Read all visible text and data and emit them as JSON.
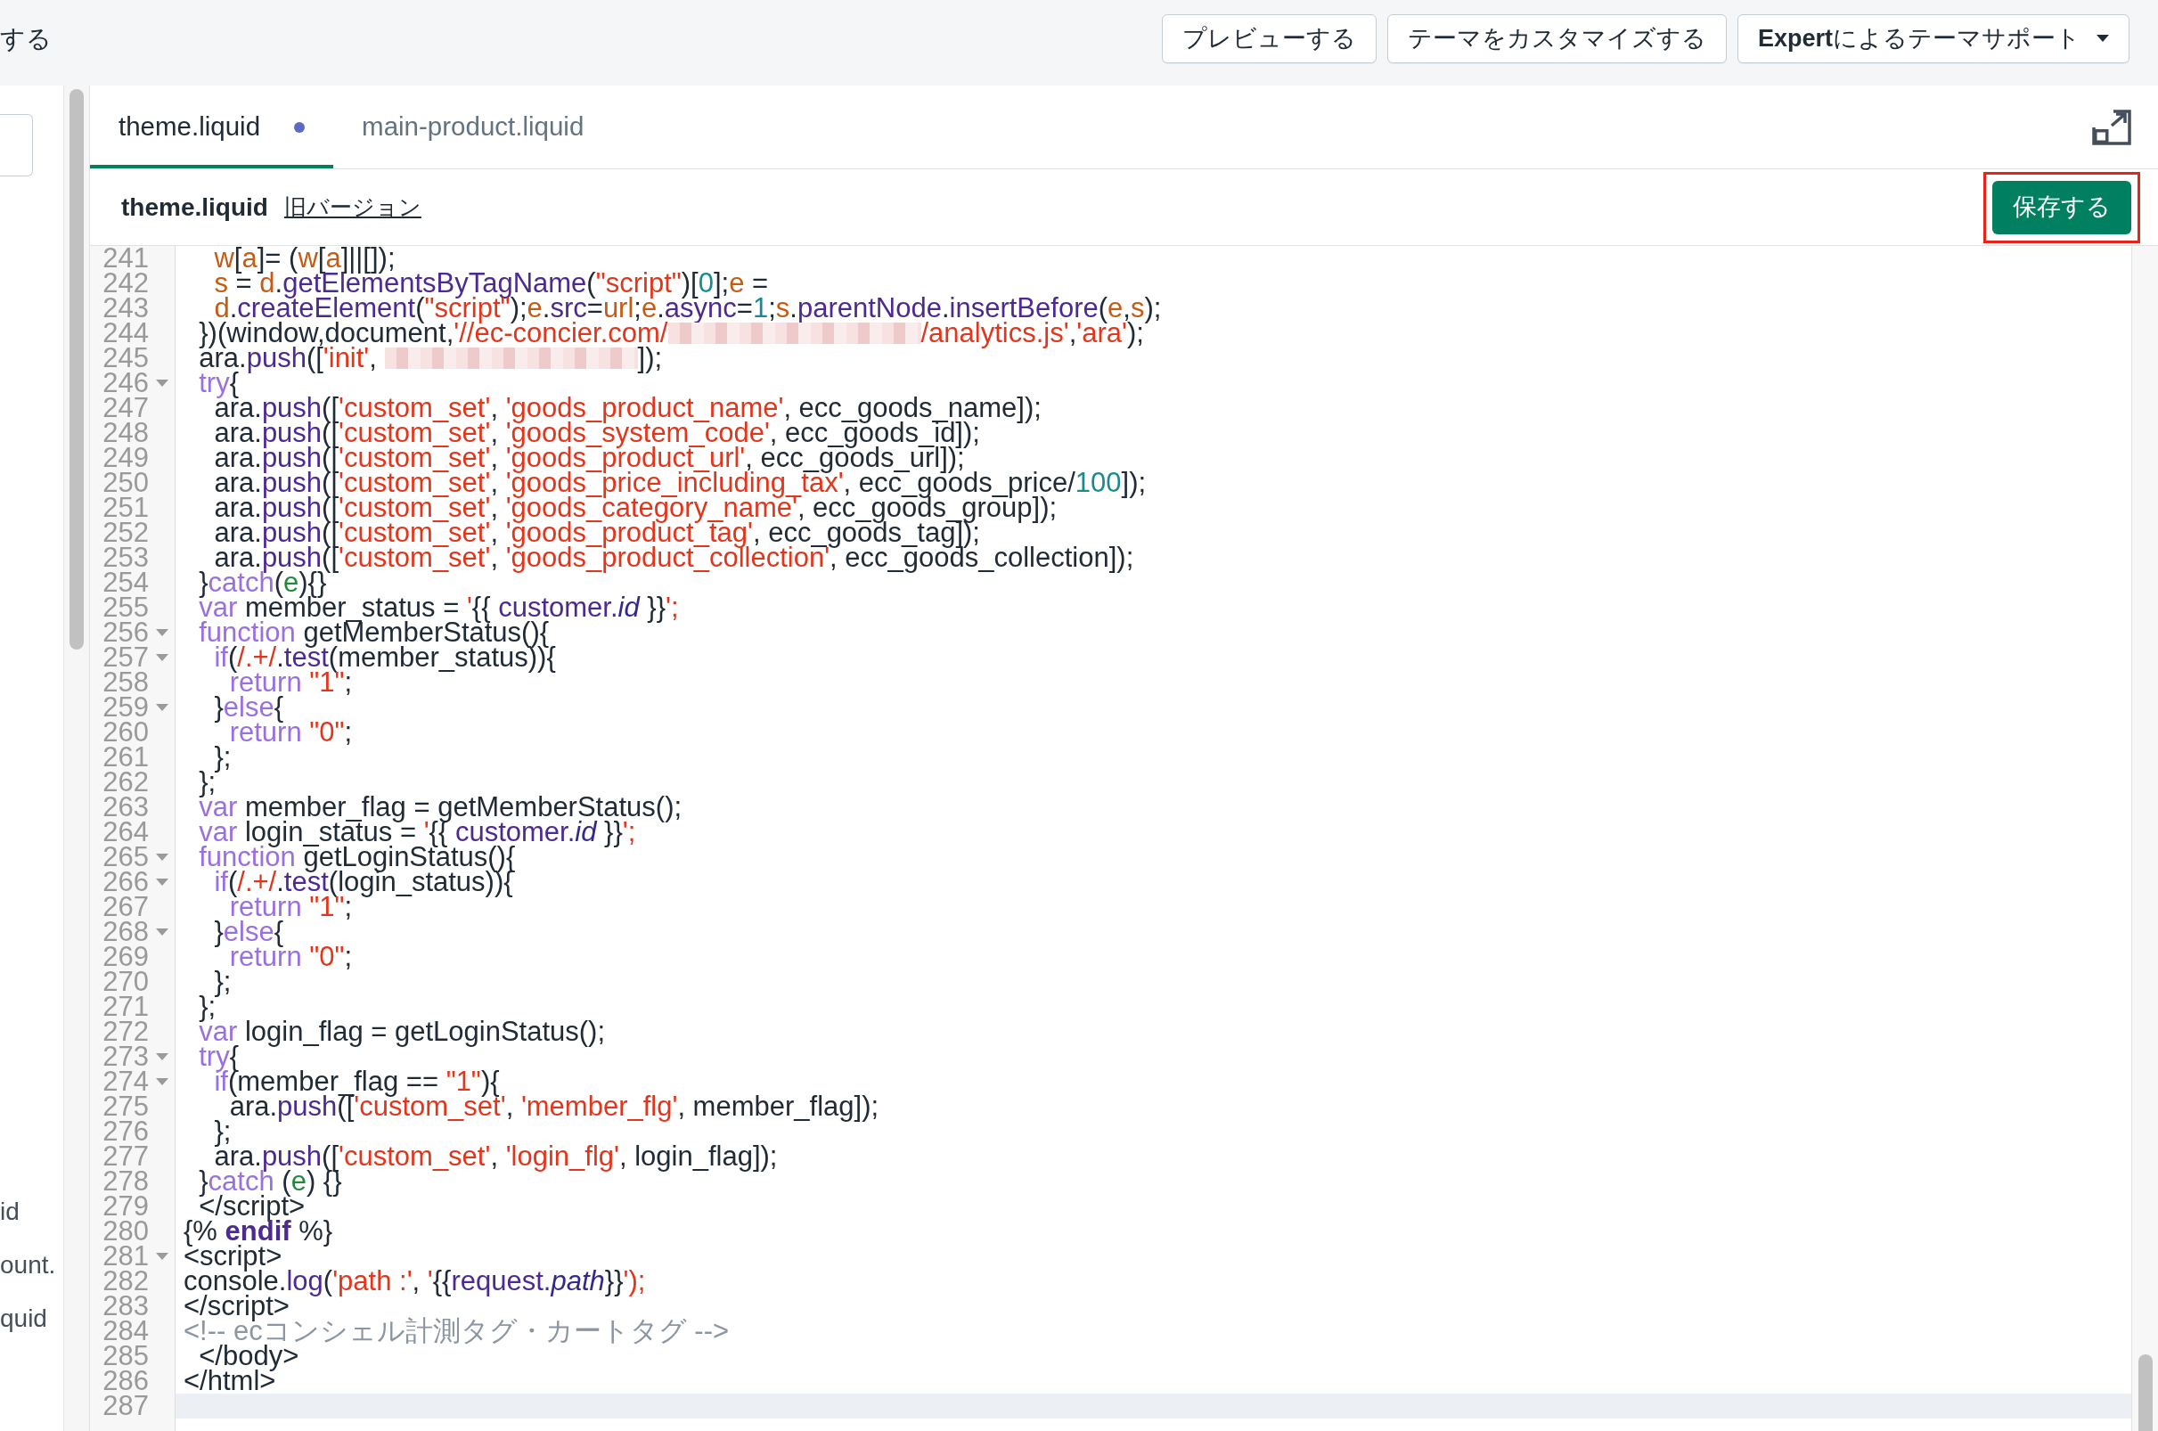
{
  "top_bar": {
    "title": "する",
    "buttons": [
      {
        "label": "プレビューする",
        "kind": "plain"
      },
      {
        "label": "テーマをカスタマイズする",
        "kind": "plain"
      },
      {
        "label": "**Expert**によるテーマサポート",
        "kind": "dropdown"
      }
    ]
  },
  "sidebar": {
    "items": [
      "id",
      "ount.",
      "quid"
    ]
  },
  "editor": {
    "tabs": [
      {
        "label": "theme.liquid",
        "selected": true,
        "modified": true
      },
      {
        "label": "main-product.liquid",
        "selected": false,
        "modified": false
      }
    ],
    "file_title": "theme.liquid",
    "old_version_link": "旧バージョン",
    "save_button": {
      "label": "保存する",
      "highlighted": true
    },
    "lines": [
      {
        "number": "241",
        "foldable": false,
        "active": false,
        "tokens": [
          {
            "kind": "variable",
            "text": "    w"
          },
          {
            "kind": "plain",
            "text": "["
          },
          {
            "kind": "variable",
            "text": "a"
          },
          {
            "kind": "plain",
            "text": "]= ("
          },
          {
            "kind": "variable",
            "text": "w"
          },
          {
            "kind": "plain",
            "text": "["
          },
          {
            "kind": "variable",
            "text": "a"
          },
          {
            "kind": "plain",
            "text": "]||[]);"
          }
        ]
      },
      {
        "number": "242",
        "foldable": false,
        "active": false,
        "tokens": [
          {
            "kind": "variable",
            "text": "    s"
          },
          {
            "kind": "plain",
            "text": " = "
          },
          {
            "kind": "variable",
            "text": "d"
          },
          {
            "kind": "plain",
            "text": "."
          },
          {
            "kind": "property",
            "text": "getElementsByTagName"
          },
          {
            "kind": "plain",
            "text": "("
          },
          {
            "kind": "string",
            "text": "\"script\""
          },
          {
            "kind": "plain",
            "text": ")["
          },
          {
            "kind": "number",
            "text": "0"
          },
          {
            "kind": "plain",
            "text": "];"
          },
          {
            "kind": "variable",
            "text": "e"
          },
          {
            "kind": "plain",
            "text": " ="
          }
        ]
      },
      {
        "number": "243",
        "foldable": false,
        "active": false,
        "tokens": [
          {
            "kind": "variable",
            "text": "    d"
          },
          {
            "kind": "plain",
            "text": "."
          },
          {
            "kind": "property",
            "text": "createElement"
          },
          {
            "kind": "plain",
            "text": "("
          },
          {
            "kind": "string",
            "text": "\"script\""
          },
          {
            "kind": "plain",
            "text": ");"
          },
          {
            "kind": "variable",
            "text": "e"
          },
          {
            "kind": "plain",
            "text": "."
          },
          {
            "kind": "property",
            "text": "src"
          },
          {
            "kind": "plain",
            "text": "="
          },
          {
            "kind": "variable",
            "text": "url"
          },
          {
            "kind": "plain",
            "text": ";"
          },
          {
            "kind": "variable",
            "text": "e"
          },
          {
            "kind": "plain",
            "text": "."
          },
          {
            "kind": "property",
            "text": "async"
          },
          {
            "kind": "plain",
            "text": "="
          },
          {
            "kind": "number",
            "text": "1"
          },
          {
            "kind": "plain",
            "text": ";"
          },
          {
            "kind": "variable",
            "text": "s"
          },
          {
            "kind": "plain",
            "text": "."
          },
          {
            "kind": "property",
            "text": "parentNode"
          },
          {
            "kind": "plain",
            "text": "."
          },
          {
            "kind": "property",
            "text": "insertBefore"
          },
          {
            "kind": "plain",
            "text": "("
          },
          {
            "kind": "variable",
            "text": "e"
          },
          {
            "kind": "plain",
            "text": ","
          },
          {
            "kind": "variable",
            "text": "s"
          },
          {
            "kind": "plain",
            "text": ");"
          }
        ]
      },
      {
        "number": "244",
        "foldable": false,
        "active": false,
        "tokens": [
          {
            "kind": "plain",
            "text": "  })(window,document,"
          },
          {
            "kind": "string",
            "text": "'//ec-concier.com/"
          },
          {
            "kind": "redacted"
          },
          {
            "kind": "string",
            "text": "/analytics.js'"
          },
          {
            "kind": "plain",
            "text": ","
          },
          {
            "kind": "string",
            "text": "'ara'"
          },
          {
            "kind": "plain",
            "text": ");"
          }
        ]
      },
      {
        "number": "245",
        "foldable": false,
        "active": false,
        "tokens": [
          {
            "kind": "plain",
            "text": "  ara."
          },
          {
            "kind": "property",
            "text": "push"
          },
          {
            "kind": "plain",
            "text": "(["
          },
          {
            "kind": "string",
            "text": "'init'"
          },
          {
            "kind": "plain",
            "text": ", "
          },
          {
            "kind": "redacted"
          },
          {
            "kind": "plain",
            "text": "]);"
          }
        ]
      },
      {
        "number": "246",
        "foldable": true,
        "active": false,
        "tokens": [
          {
            "kind": "keyword",
            "text": "  try"
          },
          {
            "kind": "plain",
            "text": "{"
          }
        ]
      },
      {
        "number": "247",
        "foldable": false,
        "active": false,
        "tokens": [
          {
            "kind": "plain",
            "text": "    ara."
          },
          {
            "kind": "property",
            "text": "push"
          },
          {
            "kind": "plain",
            "text": "(["
          },
          {
            "kind": "string",
            "text": "'custom_set'"
          },
          {
            "kind": "plain",
            "text": ", "
          },
          {
            "kind": "string",
            "text": "'goods_product_name'"
          },
          {
            "kind": "plain",
            "text": ", ecc_goods_name]);"
          }
        ]
      },
      {
        "number": "248",
        "foldable": false,
        "active": false,
        "tokens": [
          {
            "kind": "plain",
            "text": "    ara."
          },
          {
            "kind": "property",
            "text": "push"
          },
          {
            "kind": "plain",
            "text": "(["
          },
          {
            "kind": "string",
            "text": "'custom_set'"
          },
          {
            "kind": "plain",
            "text": ", "
          },
          {
            "kind": "string",
            "text": "'goods_system_code'"
          },
          {
            "kind": "plain",
            "text": ", ecc_goods_id]);"
          }
        ]
      },
      {
        "number": "249",
        "foldable": false,
        "active": false,
        "tokens": [
          {
            "kind": "plain",
            "text": "    ara."
          },
          {
            "kind": "property",
            "text": "push"
          },
          {
            "kind": "plain",
            "text": "(["
          },
          {
            "kind": "string",
            "text": "'custom_set'"
          },
          {
            "kind": "plain",
            "text": ", "
          },
          {
            "kind": "string",
            "text": "'goods_product_url'"
          },
          {
            "kind": "plain",
            "text": ", ecc_goods_url]);"
          }
        ]
      },
      {
        "number": "250",
        "foldable": false,
        "active": false,
        "tokens": [
          {
            "kind": "plain",
            "text": "    ara."
          },
          {
            "kind": "property",
            "text": "push"
          },
          {
            "kind": "plain",
            "text": "(["
          },
          {
            "kind": "string",
            "text": "'custom_set'"
          },
          {
            "kind": "plain",
            "text": ", "
          },
          {
            "kind": "string",
            "text": "'goods_price_including_tax'"
          },
          {
            "kind": "plain",
            "text": ", ecc_goods_price/"
          },
          {
            "kind": "number",
            "text": "100"
          },
          {
            "kind": "plain",
            "text": "]);"
          }
        ]
      },
      {
        "number": "251",
        "foldable": false,
        "active": false,
        "tokens": [
          {
            "kind": "plain",
            "text": "    ara."
          },
          {
            "kind": "property",
            "text": "push"
          },
          {
            "kind": "plain",
            "text": "(["
          },
          {
            "kind": "string",
            "text": "'custom_set'"
          },
          {
            "kind": "plain",
            "text": ", "
          },
          {
            "kind": "string",
            "text": "'goods_category_name'"
          },
          {
            "kind": "plain",
            "text": ", ecc_goods_group]);"
          }
        ]
      },
      {
        "number": "252",
        "foldable": false,
        "active": false,
        "tokens": [
          {
            "kind": "plain",
            "text": "    ara."
          },
          {
            "kind": "property",
            "text": "push"
          },
          {
            "kind": "plain",
            "text": "(["
          },
          {
            "kind": "string",
            "text": "'custom_set'"
          },
          {
            "kind": "plain",
            "text": ", "
          },
          {
            "kind": "string",
            "text": "'goods_product_tag'"
          },
          {
            "kind": "plain",
            "text": ", ecc_goods_tag]);"
          }
        ]
      },
      {
        "number": "253",
        "foldable": false,
        "active": false,
        "tokens": [
          {
            "kind": "plain",
            "text": "    ara."
          },
          {
            "kind": "property",
            "text": "push"
          },
          {
            "kind": "plain",
            "text": "(["
          },
          {
            "kind": "string",
            "text": "'custom_set'"
          },
          {
            "kind": "plain",
            "text": ", "
          },
          {
            "kind": "string",
            "text": "'goods_product_collection'"
          },
          {
            "kind": "plain",
            "text": ", ecc_goods_collection]);"
          }
        ]
      },
      {
        "number": "254",
        "foldable": false,
        "active": false,
        "tokens": [
          {
            "kind": "plain",
            "text": "  }"
          },
          {
            "kind": "keyword",
            "text": "catch"
          },
          {
            "kind": "plain",
            "text": "("
          },
          {
            "kind": "param",
            "text": "e"
          },
          {
            "kind": "plain",
            "text": "){}"
          }
        ]
      },
      {
        "number": "255",
        "foldable": false,
        "active": false,
        "tokens": [
          {
            "kind": "keyword",
            "text": "  var"
          },
          {
            "kind": "plain",
            "text": " member_status = "
          },
          {
            "kind": "string",
            "text": "'"
          },
          {
            "kind": "plain",
            "text": "{{ "
          },
          {
            "kind": "property",
            "text": "customer."
          },
          {
            "kind": "italic_property",
            "text": "id"
          },
          {
            "kind": "plain",
            "text": " }}"
          },
          {
            "kind": "string",
            "text": "';"
          }
        ]
      },
      {
        "number": "256",
        "foldable": true,
        "active": false,
        "tokens": [
          {
            "kind": "keyword",
            "text": "  function"
          },
          {
            "kind": "plain",
            "text": " getMemberStatus(){"
          }
        ]
      },
      {
        "number": "257",
        "foldable": true,
        "active": false,
        "tokens": [
          {
            "kind": "keyword",
            "text": "    if"
          },
          {
            "kind": "plain",
            "text": "("
          },
          {
            "kind": "string",
            "text": "/.+/"
          },
          {
            "kind": "plain",
            "text": "."
          },
          {
            "kind": "property",
            "text": "test"
          },
          {
            "kind": "plain",
            "text": "(member_status)){"
          }
        ]
      },
      {
        "number": "258",
        "foldable": false,
        "active": false,
        "tokens": [
          {
            "kind": "keyword",
            "text": "      return"
          },
          {
            "kind": "string",
            "text": " \"1\""
          },
          {
            "kind": "plain",
            "text": ";"
          }
        ]
      },
      {
        "number": "259",
        "foldable": true,
        "active": false,
        "tokens": [
          {
            "kind": "plain",
            "text": "    }"
          },
          {
            "kind": "keyword",
            "text": "else"
          },
          {
            "kind": "plain",
            "text": "{"
          }
        ]
      },
      {
        "number": "260",
        "foldable": false,
        "active": false,
        "tokens": [
          {
            "kind": "keyword",
            "text": "      return"
          },
          {
            "kind": "string",
            "text": " \"0\""
          },
          {
            "kind": "plain",
            "text": ";"
          }
        ]
      },
      {
        "number": "261",
        "foldable": false,
        "active": false,
        "tokens": [
          {
            "kind": "plain",
            "text": "    };"
          }
        ]
      },
      {
        "number": "262",
        "foldable": false,
        "active": false,
        "tokens": [
          {
            "kind": "plain",
            "text": "  };"
          }
        ]
      },
      {
        "number": "263",
        "foldable": false,
        "active": false,
        "tokens": [
          {
            "kind": "keyword",
            "text": "  var"
          },
          {
            "kind": "plain",
            "text": " member_flag = getMemberStatus();"
          }
        ]
      },
      {
        "number": "264",
        "foldable": false,
        "active": false,
        "tokens": [
          {
            "kind": "keyword",
            "text": "  var"
          },
          {
            "kind": "plain",
            "text": " login_status = "
          },
          {
            "kind": "string",
            "text": "'"
          },
          {
            "kind": "plain",
            "text": "{{ "
          },
          {
            "kind": "property",
            "text": "customer."
          },
          {
            "kind": "italic_property",
            "text": "id"
          },
          {
            "kind": "plain",
            "text": " }}"
          },
          {
            "kind": "string",
            "text": "';"
          }
        ]
      },
      {
        "number": "265",
        "foldable": true,
        "active": false,
        "tokens": [
          {
            "kind": "keyword",
            "text": "  function"
          },
          {
            "kind": "plain",
            "text": " getLoginStatus(){"
          }
        ]
      },
      {
        "number": "266",
        "foldable": true,
        "active": false,
        "tokens": [
          {
            "kind": "keyword",
            "text": "    if"
          },
          {
            "kind": "plain",
            "text": "("
          },
          {
            "kind": "string",
            "text": "/.+/"
          },
          {
            "kind": "plain",
            "text": "."
          },
          {
            "kind": "property",
            "text": "test"
          },
          {
            "kind": "plain",
            "text": "(login_status)){"
          }
        ]
      },
      {
        "number": "267",
        "foldable": false,
        "active": false,
        "tokens": [
          {
            "kind": "keyword",
            "text": "      return"
          },
          {
            "kind": "string",
            "text": " \"1\""
          },
          {
            "kind": "plain",
            "text": ";"
          }
        ]
      },
      {
        "number": "268",
        "foldable": true,
        "active": false,
        "tokens": [
          {
            "kind": "plain",
            "text": "    }"
          },
          {
            "kind": "keyword",
            "text": "else"
          },
          {
            "kind": "plain",
            "text": "{"
          }
        ]
      },
      {
        "number": "269",
        "foldable": false,
        "active": false,
        "tokens": [
          {
            "kind": "keyword",
            "text": "      return"
          },
          {
            "kind": "string",
            "text": " \"0\""
          },
          {
            "kind": "plain",
            "text": ";"
          }
        ]
      },
      {
        "number": "270",
        "foldable": false,
        "active": false,
        "tokens": [
          {
            "kind": "plain",
            "text": "    };"
          }
        ]
      },
      {
        "number": "271",
        "foldable": false,
        "active": false,
        "tokens": [
          {
            "kind": "plain",
            "text": "  };"
          }
        ]
      },
      {
        "number": "272",
        "foldable": false,
        "active": false,
        "tokens": [
          {
            "kind": "keyword",
            "text": "  var"
          },
          {
            "kind": "plain",
            "text": " login_flag = getLoginStatus();"
          }
        ]
      },
      {
        "number": "273",
        "foldable": true,
        "active": false,
        "tokens": [
          {
            "kind": "keyword",
            "text": "  try"
          },
          {
            "kind": "plain",
            "text": "{"
          }
        ]
      },
      {
        "number": "274",
        "foldable": true,
        "active": false,
        "tokens": [
          {
            "kind": "keyword",
            "text": "    if"
          },
          {
            "kind": "plain",
            "text": "(member_flag == "
          },
          {
            "kind": "string",
            "text": "\"1\""
          },
          {
            "kind": "plain",
            "text": "){"
          }
        ]
      },
      {
        "number": "275",
        "foldable": false,
        "active": false,
        "tokens": [
          {
            "kind": "plain",
            "text": "      ara."
          },
          {
            "kind": "property",
            "text": "push"
          },
          {
            "kind": "plain",
            "text": "(["
          },
          {
            "kind": "string",
            "text": "'custom_set'"
          },
          {
            "kind": "plain",
            "text": ", "
          },
          {
            "kind": "string",
            "text": "'member_flg'"
          },
          {
            "kind": "plain",
            "text": ", member_flag]);"
          }
        ]
      },
      {
        "number": "276",
        "foldable": false,
        "active": false,
        "tokens": [
          {
            "kind": "plain",
            "text": "    };"
          }
        ]
      },
      {
        "number": "277",
        "foldable": false,
        "active": false,
        "tokens": [
          {
            "kind": "plain",
            "text": "    ara."
          },
          {
            "kind": "property",
            "text": "push"
          },
          {
            "kind": "plain",
            "text": "(["
          },
          {
            "kind": "string",
            "text": "'custom_set'"
          },
          {
            "kind": "plain",
            "text": ", "
          },
          {
            "kind": "string",
            "text": "'login_flg'"
          },
          {
            "kind": "plain",
            "text": ", login_flag]);"
          }
        ]
      },
      {
        "number": "278",
        "foldable": false,
        "active": false,
        "tokens": [
          {
            "kind": "plain",
            "text": "  }"
          },
          {
            "kind": "keyword",
            "text": "catch"
          },
          {
            "kind": "plain",
            "text": " ("
          },
          {
            "kind": "param",
            "text": "e"
          },
          {
            "kind": "plain",
            "text": ") {}"
          }
        ]
      },
      {
        "number": "279",
        "foldable": false,
        "active": false,
        "tokens": [
          {
            "kind": "plain",
            "text": "  </script>"
          }
        ]
      },
      {
        "number": "280",
        "foldable": false,
        "active": false,
        "tokens": [
          {
            "kind": "plain",
            "text": "{% "
          },
          {
            "kind": "liquid_tag",
            "text": "endif"
          },
          {
            "kind": "plain",
            "text": " %}"
          }
        ]
      },
      {
        "number": "281",
        "foldable": true,
        "active": false,
        "tokens": [
          {
            "kind": "plain",
            "text": "<script>"
          }
        ]
      },
      {
        "number": "282",
        "foldable": false,
        "active": false,
        "tokens": [
          {
            "kind": "plain",
            "text": "console."
          },
          {
            "kind": "property",
            "text": "log"
          },
          {
            "kind": "plain",
            "text": "("
          },
          {
            "kind": "string",
            "text": "'path :'"
          },
          {
            "kind": "plain",
            "text": ", "
          },
          {
            "kind": "string",
            "text": "'"
          },
          {
            "kind": "plain",
            "text": "{{"
          },
          {
            "kind": "property",
            "text": "request."
          },
          {
            "kind": "italic_property",
            "text": "path"
          },
          {
            "kind": "plain",
            "text": "}}"
          },
          {
            "kind": "string",
            "text": "');"
          }
        ]
      },
      {
        "number": "283",
        "foldable": false,
        "active": false,
        "tokens": [
          {
            "kind": "plain",
            "text": "</script>"
          }
        ]
      },
      {
        "number": "284",
        "foldable": false,
        "active": false,
        "tokens": [
          {
            "kind": "comment",
            "text": "<!-- ecコンシェル計測タグ・カートタグ -->"
          }
        ]
      },
      {
        "number": "285",
        "foldable": false,
        "active": false,
        "tokens": [
          {
            "kind": "plain",
            "text": "  </body>"
          }
        ]
      },
      {
        "number": "286",
        "foldable": false,
        "active": false,
        "tokens": [
          {
            "kind": "plain",
            "text": "</html>"
          }
        ]
      },
      {
        "number": "287",
        "foldable": false,
        "active": true
      }
    ]
  }
}
